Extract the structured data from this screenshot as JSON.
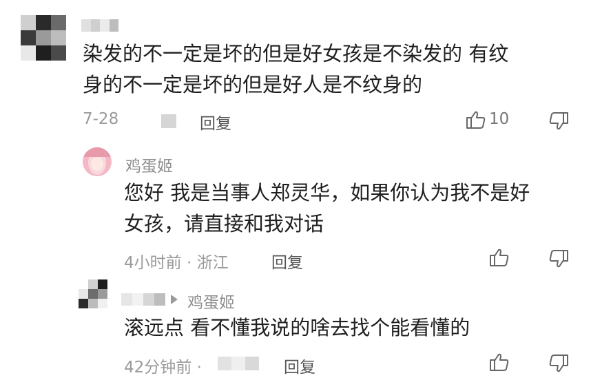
{
  "comments": [
    {
      "text_line1": "染发的不一定是坏的但是好女孩是不染发的 有纹",
      "text_line2": "身的不一定是坏的但是好人是不纹身的",
      "date": "7-28",
      "reply_label": "回复",
      "like_count": "10"
    },
    {
      "username": "鸡蛋姬",
      "text_line1": "您好 我是当事人郑灵华，如果你认为我不是好",
      "text_line2": "女孩，请直接和我对话",
      "time": "4小时前 · 浙江",
      "reply_label": "回复"
    },
    {
      "reply_target": "鸡蛋姬",
      "text_line1": "滚远点 看不懂我说的啥去找个能看懂的",
      "time": "42分钟前 ·",
      "reply_label": "回复"
    }
  ],
  "colors": {
    "text": "#1f1f1f",
    "meta": "#9a9a9a",
    "avatar_pink": "#f2b8c4"
  },
  "icons": [
    "thumbs-up-icon",
    "thumbs-down-icon",
    "reply-arrow-icon"
  ]
}
